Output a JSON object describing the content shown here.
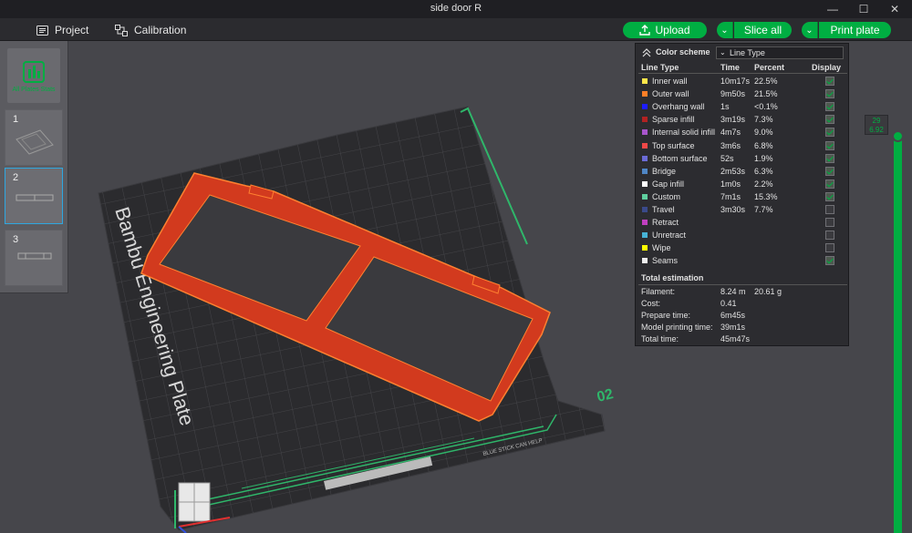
{
  "window": {
    "title": "side door R",
    "minimize_glyph": "—",
    "maximize_glyph": "☐",
    "close_glyph": "✕"
  },
  "toolbar": {
    "project_label": "Project",
    "calibration_label": "Calibration",
    "upload_label": "Upload",
    "slice_all_label": "Slice all",
    "print_plate_label": "Print plate",
    "accent_color": "#00ae42"
  },
  "sidebar": {
    "all_plates_label": "All Plates Stats",
    "plates": [
      {
        "number": "1",
        "selected": false
      },
      {
        "number": "2",
        "selected": true
      },
      {
        "number": "3",
        "selected": false
      }
    ]
  },
  "scene": {
    "plate_brand_text": "Bambu Engineering Plate",
    "plate_number_text": "02",
    "plate_label_small": "BLUE STICK CAN HELP"
  },
  "legend": {
    "color_scheme_label": "Color scheme",
    "color_scheme_value": "Line Type",
    "columns": {
      "type": "Line Type",
      "time": "Time",
      "percent": "Percent",
      "display": "Display"
    },
    "rows": [
      {
        "name": "Inner wall",
        "time": "10m17s",
        "percent": "22.5%",
        "color": "#ffe74a",
        "display": true
      },
      {
        "name": "Outer wall",
        "time": "9m50s",
        "percent": "21.5%",
        "color": "#ff7f27",
        "display": true
      },
      {
        "name": "Overhang wall",
        "time": "1s",
        "percent": "<0.1%",
        "color": "#1d1dff",
        "display": true
      },
      {
        "name": "Sparse infill",
        "time": "3m19s",
        "percent": "7.3%",
        "color": "#b22222",
        "display": true
      },
      {
        "name": "Internal solid infill",
        "time": "4m7s",
        "percent": "9.0%",
        "color": "#a855cc",
        "display": true
      },
      {
        "name": "Top surface",
        "time": "3m6s",
        "percent": "6.8%",
        "color": "#f04848",
        "display": true
      },
      {
        "name": "Bottom surface",
        "time": "52s",
        "percent": "1.9%",
        "color": "#6b6bd6",
        "display": true
      },
      {
        "name": "Bridge",
        "time": "2m53s",
        "percent": "6.3%",
        "color": "#4f86c6",
        "display": true
      },
      {
        "name": "Gap infill",
        "time": "1m0s",
        "percent": "2.2%",
        "color": "#ffffff",
        "display": true
      },
      {
        "name": "Custom",
        "time": "7m1s",
        "percent": "15.3%",
        "color": "#5fcf9f",
        "display": true
      },
      {
        "name": "Travel",
        "time": "3m30s",
        "percent": "7.7%",
        "color": "#3a4a8a",
        "display": false
      },
      {
        "name": "Retract",
        "time": "",
        "percent": "",
        "color": "#c03fc0",
        "display": false
      },
      {
        "name": "Unretract",
        "time": "",
        "percent": "",
        "color": "#47b3d6",
        "display": false
      },
      {
        "name": "Wipe",
        "time": "",
        "percent": "",
        "color": "#ffff00",
        "display": false
      },
      {
        "name": "Seams",
        "time": "",
        "percent": "",
        "color": "#efefef",
        "display": true
      }
    ],
    "total_estimation_label": "Total estimation",
    "totals": {
      "filament_label": "Filament:",
      "filament_length": "8.24 m",
      "filament_weight": "20.61 g",
      "cost_label": "Cost:",
      "cost": "0.41",
      "prepare_label": "Prepare time:",
      "prepare": "6m45s",
      "model_label": "Model printing time:",
      "model": "39m1s",
      "total_label": "Total time:",
      "total": "45m47s"
    }
  },
  "layer_slider": {
    "layer": "29",
    "height": "6.92"
  }
}
